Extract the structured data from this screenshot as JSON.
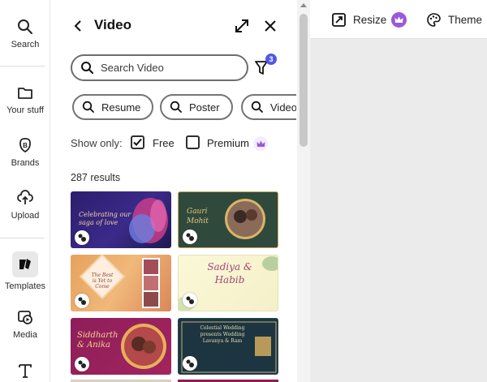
{
  "sidebar": {
    "items": [
      {
        "label": "Search",
        "icon": "search-icon"
      },
      {
        "label": "Your stuff",
        "icon": "folder-icon"
      },
      {
        "label": "Brands",
        "icon": "brand-icon"
      },
      {
        "label": "Upload",
        "icon": "upload-icon"
      },
      {
        "label": "Templates",
        "icon": "templates-icon"
      },
      {
        "label": "Media",
        "icon": "media-icon"
      },
      {
        "label": "Text",
        "icon": "text-icon"
      }
    ]
  },
  "panel": {
    "title": "Video",
    "search": {
      "placeholder": "Search Video",
      "value": ""
    },
    "filter_badge": "3",
    "chips": [
      "Resume",
      "Poster",
      "Video"
    ],
    "show_only_label": "Show only:",
    "free_label": "Free",
    "free_checked": true,
    "premium_label": "Premium",
    "premium_checked": false,
    "results_count": "287 results",
    "templates": [
      {
        "caption": "Celebrating our saga of love"
      },
      {
        "caption": "Gauri Mohit"
      },
      {
        "caption": "The Best is Yet to Come"
      },
      {
        "caption": "Sadiya & Habib"
      },
      {
        "caption": "Siddharth & Anika"
      },
      {
        "caption": "Celestial Wedding presents Wedding Lavanya & Ram"
      }
    ]
  },
  "toolbar": {
    "resize_label": "Resize",
    "theme_label": "Theme"
  },
  "colors": {
    "accent": "#5258e4",
    "premium": "#9b59d8"
  }
}
